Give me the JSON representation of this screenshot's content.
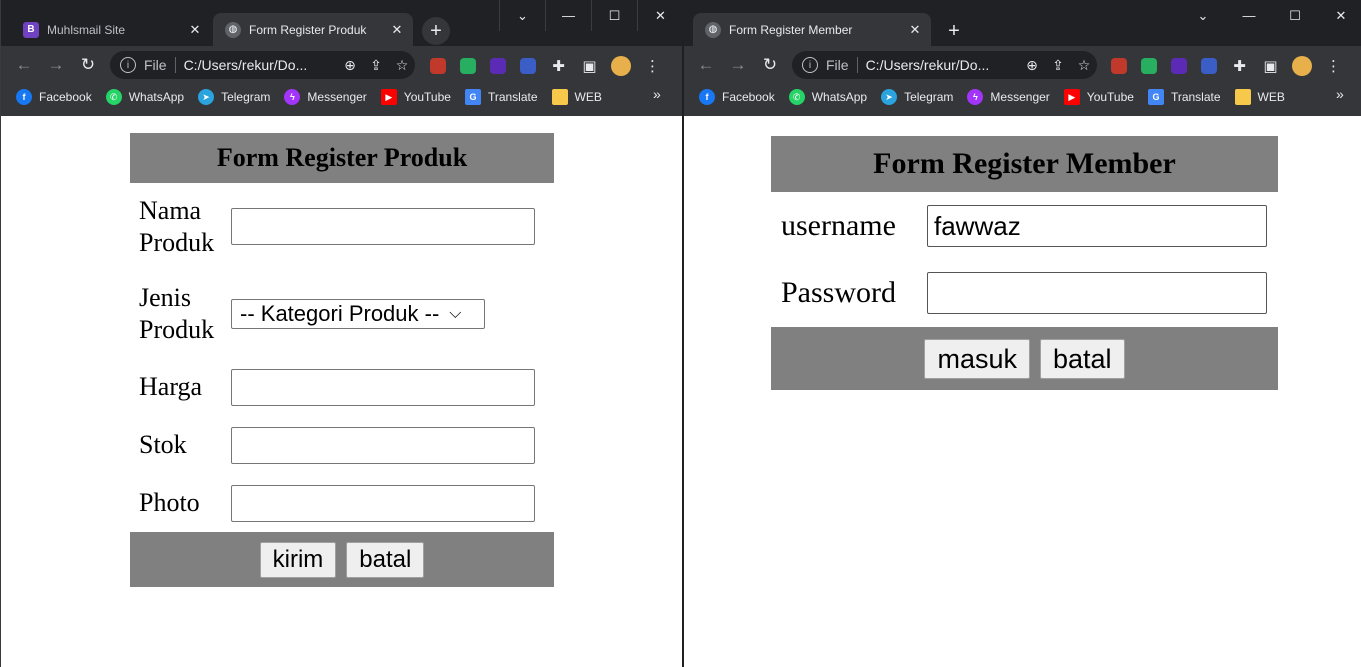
{
  "left_window": {
    "tabs": [
      {
        "title": "Muhlsmail Site",
        "favicon": "B"
      },
      {
        "title": "Form Register Produk"
      }
    ],
    "address": {
      "scheme": "File",
      "url": "C:/Users/rekur/Do..."
    },
    "bookmarks": [
      "Facebook",
      "WhatsApp",
      "Telegram",
      "Messenger",
      "YouTube",
      "Translate",
      "WEB"
    ],
    "form": {
      "title": "Form Register Produk",
      "fields": {
        "nama_produk_label": [
          "Nama",
          "Produk"
        ],
        "jenis_produk_label": [
          "Jenis",
          "Produk"
        ],
        "harga_label": "Harga",
        "stok_label": "Stok",
        "photo_label": "Photo"
      },
      "category_select": "-- Kategori Produk --",
      "buttons": {
        "submit": "kirim",
        "cancel": "batal"
      }
    }
  },
  "right_window": {
    "tabs": [
      {
        "title": "Form Register Member"
      }
    ],
    "address": {
      "scheme": "File",
      "url": "C:/Users/rekur/Do..."
    },
    "bookmarks": [
      "Facebook",
      "WhatsApp",
      "Telegram",
      "Messenger",
      "YouTube",
      "Translate",
      "WEB"
    ],
    "form": {
      "title": "Form Register Member",
      "username_label": "username",
      "username_value": "fawwaz",
      "password_label": "Password",
      "password_value": "",
      "buttons": {
        "submit": "masuk",
        "cancel": "batal"
      }
    }
  },
  "colors": {
    "tabstrip": "#202124",
    "toolbar": "#35363a",
    "form_header": "#808080"
  }
}
